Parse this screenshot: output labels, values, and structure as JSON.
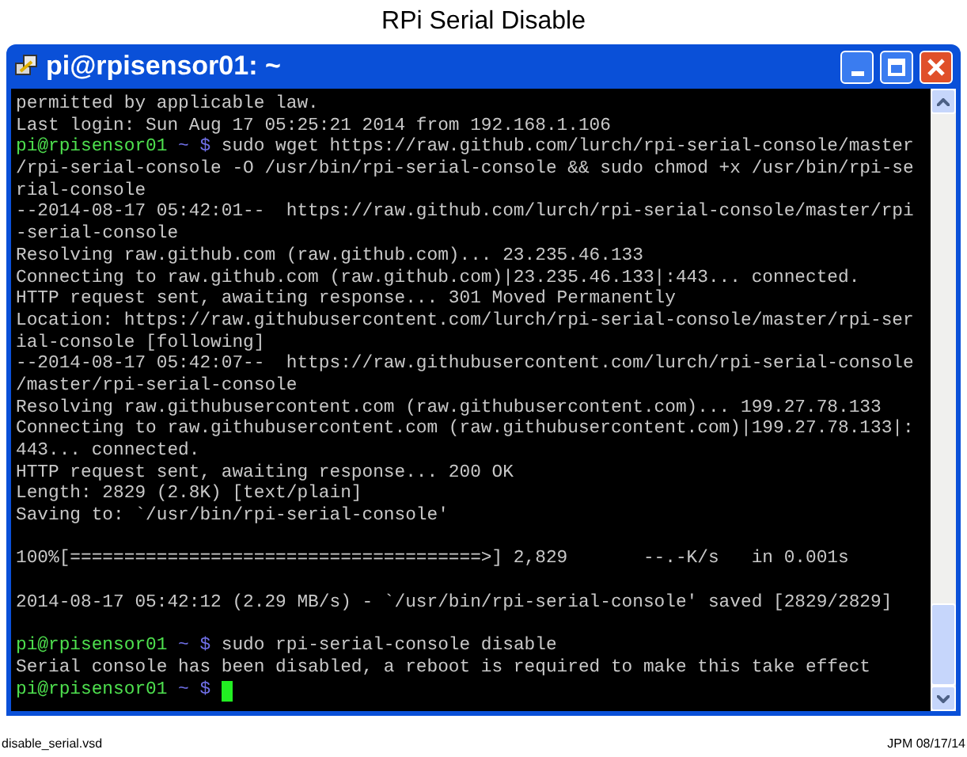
{
  "page_title": "RPi Serial Disable",
  "window": {
    "title": "pi@rpisensor01: ~"
  },
  "terminal": {
    "lines": [
      {
        "kind": "output",
        "text": "permitted by applicable law."
      },
      {
        "kind": "output",
        "text": "Last login: Sun Aug 17 05:25:21 2014 from 192.168.1.106"
      },
      {
        "kind": "prompt",
        "user": "pi@rpisensor01",
        "path": "~ $",
        "command": "sudo wget https://raw.github.com/lurch/rpi-serial-console/master",
        "cursor": false
      },
      {
        "kind": "output",
        "text": "/rpi-serial-console -O /usr/bin/rpi-serial-console && sudo chmod +x /usr/bin/rpi-se"
      },
      {
        "kind": "output",
        "text": "rial-console"
      },
      {
        "kind": "output",
        "text": "--2014-08-17 05:42:01--  https://raw.github.com/lurch/rpi-serial-console/master/rpi"
      },
      {
        "kind": "output",
        "text": "-serial-console"
      },
      {
        "kind": "output",
        "text": "Resolving raw.github.com (raw.github.com)... 23.235.46.133"
      },
      {
        "kind": "output",
        "text": "Connecting to raw.github.com (raw.github.com)|23.235.46.133|:443... connected."
      },
      {
        "kind": "output",
        "text": "HTTP request sent, awaiting response... 301 Moved Permanently"
      },
      {
        "kind": "output",
        "text": "Location: https://raw.githubusercontent.com/lurch/rpi-serial-console/master/rpi-ser"
      },
      {
        "kind": "output",
        "text": "ial-console [following]"
      },
      {
        "kind": "output",
        "text": "--2014-08-17 05:42:07--  https://raw.githubusercontent.com/lurch/rpi-serial-console"
      },
      {
        "kind": "output",
        "text": "/master/rpi-serial-console"
      },
      {
        "kind": "output",
        "text": "Resolving raw.githubusercontent.com (raw.githubusercontent.com)... 199.27.78.133"
      },
      {
        "kind": "output",
        "text": "Connecting to raw.githubusercontent.com (raw.githubusercontent.com)|199.27.78.133|:"
      },
      {
        "kind": "output",
        "text": "443... connected."
      },
      {
        "kind": "output",
        "text": "HTTP request sent, awaiting response... 200 OK"
      },
      {
        "kind": "output",
        "text": "Length: 2829 (2.8K) [text/plain]"
      },
      {
        "kind": "output",
        "text": "Saving to: `/usr/bin/rpi-serial-console'"
      },
      {
        "kind": "blank"
      },
      {
        "kind": "output",
        "text": "100%[======================================>] 2,829       --.-K/s   in 0.001s"
      },
      {
        "kind": "blank"
      },
      {
        "kind": "output",
        "text": "2014-08-17 05:42:12 (2.29 MB/s) - `/usr/bin/rpi-serial-console' saved [2829/2829]"
      },
      {
        "kind": "blank"
      },
      {
        "kind": "prompt",
        "user": "pi@rpisensor01",
        "path": "~ $",
        "command": "sudo rpi-serial-console disable",
        "cursor": false
      },
      {
        "kind": "output",
        "text": "Serial console has been disabled, a reboot is required to make this take effect"
      },
      {
        "kind": "prompt",
        "user": "pi@rpisensor01",
        "path": "~ $",
        "cursor": true
      }
    ]
  },
  "footer": {
    "file": "disable_serial.vsd",
    "author_date": "JPM 08/17/14"
  }
}
